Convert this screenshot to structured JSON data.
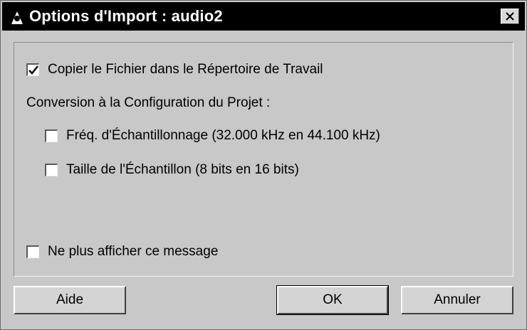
{
  "window": {
    "title": "Options d'Import : audio2",
    "close_label": "×"
  },
  "options": {
    "copy_file": {
      "label": "Copier le Fichier dans le Répertoire de Travail",
      "checked": true
    },
    "conversion_heading": "Conversion à la Configuration du Projet :",
    "sample_rate": {
      "label": "Fréq. d'Échantillonnage (32.000 kHz en 44.100 kHz)",
      "checked": false
    },
    "sample_size": {
      "label": "Taille de l'Échantillon (8 bits en 16 bits)",
      "checked": false
    },
    "dont_show": {
      "label": "Ne plus afficher ce message",
      "checked": false
    }
  },
  "buttons": {
    "help": "Aide",
    "ok": "OK",
    "cancel": "Annuler"
  },
  "colors": {
    "titlebar": "#000000",
    "dialog_bg": "#c8c8c8"
  }
}
